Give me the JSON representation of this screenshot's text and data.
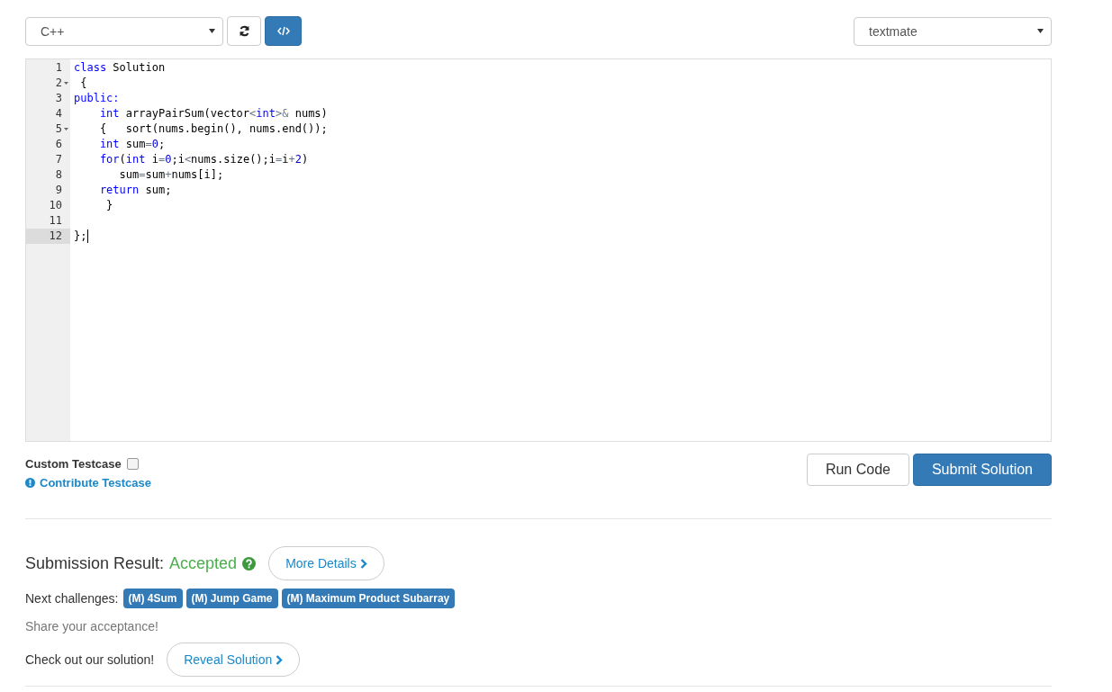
{
  "toolbar": {
    "language": "C++",
    "theme": "textmate"
  },
  "editor": {
    "lines": [
      {
        "number": "1",
        "foldable": false,
        "active": false,
        "tokens": [
          {
            "text": "class",
            "kind": "keyword"
          },
          {
            "text": " Solution",
            "kind": "plain"
          }
        ]
      },
      {
        "number": "2",
        "foldable": true,
        "active": false,
        "tokens": [
          {
            "text": " {",
            "kind": "plain"
          }
        ]
      },
      {
        "number": "3",
        "foldable": false,
        "active": false,
        "tokens": [
          {
            "text": "public:",
            "kind": "keyword"
          }
        ]
      },
      {
        "number": "4",
        "foldable": false,
        "active": false,
        "tokens": [
          {
            "text": "    int",
            "kind": "keyword"
          },
          {
            "text": " arrayPairSum(vector",
            "kind": "plain"
          },
          {
            "text": "<",
            "kind": "operator"
          },
          {
            "text": "int",
            "kind": "keyword"
          },
          {
            "text": ">&",
            "kind": "operator"
          },
          {
            "text": " nums)",
            "kind": "plain"
          }
        ]
      },
      {
        "number": "5",
        "foldable": true,
        "active": false,
        "tokens": [
          {
            "text": "    {   sort(nums.begin(), nums.end());",
            "kind": "plain"
          }
        ]
      },
      {
        "number": "6",
        "foldable": false,
        "active": false,
        "tokens": [
          {
            "text": "    int",
            "kind": "keyword"
          },
          {
            "text": " sum",
            "kind": "plain"
          },
          {
            "text": "=",
            "kind": "operator"
          },
          {
            "text": "0",
            "kind": "number"
          },
          {
            "text": ";",
            "kind": "plain"
          }
        ]
      },
      {
        "number": "7",
        "foldable": false,
        "active": false,
        "tokens": [
          {
            "text": "    for",
            "kind": "keyword"
          },
          {
            "text": "(",
            "kind": "plain"
          },
          {
            "text": "int",
            "kind": "keyword"
          },
          {
            "text": " i",
            "kind": "plain"
          },
          {
            "text": "=",
            "kind": "operator"
          },
          {
            "text": "0",
            "kind": "number"
          },
          {
            "text": ";i",
            "kind": "plain"
          },
          {
            "text": "<",
            "kind": "operator"
          },
          {
            "text": "nums.size();i",
            "kind": "plain"
          },
          {
            "text": "=",
            "kind": "operator"
          },
          {
            "text": "i",
            "kind": "plain"
          },
          {
            "text": "+",
            "kind": "operator"
          },
          {
            "text": "2",
            "kind": "number"
          },
          {
            "text": ")",
            "kind": "plain"
          }
        ]
      },
      {
        "number": "8",
        "foldable": false,
        "active": false,
        "tokens": [
          {
            "text": "       sum",
            "kind": "plain"
          },
          {
            "text": "=",
            "kind": "operator"
          },
          {
            "text": "sum",
            "kind": "plain"
          },
          {
            "text": "+",
            "kind": "operator"
          },
          {
            "text": "nums[i];",
            "kind": "plain"
          }
        ]
      },
      {
        "number": "9",
        "foldable": false,
        "active": false,
        "tokens": [
          {
            "text": "    return",
            "kind": "keyword"
          },
          {
            "text": " sum;",
            "kind": "plain"
          }
        ]
      },
      {
        "number": "10",
        "foldable": false,
        "active": false,
        "tokens": [
          {
            "text": "     }",
            "kind": "plain"
          }
        ]
      },
      {
        "number": "11",
        "foldable": false,
        "active": false
      },
      {
        "number": "12",
        "foldable": false,
        "active": true,
        "tokens": [
          {
            "text": "};",
            "kind": "plain"
          }
        ]
      }
    ]
  },
  "testcase": {
    "label": "Custom Testcase",
    "checked": false,
    "contribute_link": "Contribute Testcase"
  },
  "actions": {
    "run": "Run Code",
    "submit": "Submit Solution"
  },
  "result": {
    "label": "Submission Result:",
    "status": "Accepted",
    "details_button": "More Details"
  },
  "next": {
    "label": "Next challenges:",
    "challenges": [
      "(M) 4Sum",
      "(M) Jump Game",
      "(M) Maximum Product Subarray"
    ]
  },
  "share": "Share your acceptance!",
  "solution": {
    "label": "Check out our solution!",
    "button": "Reveal Solution"
  }
}
